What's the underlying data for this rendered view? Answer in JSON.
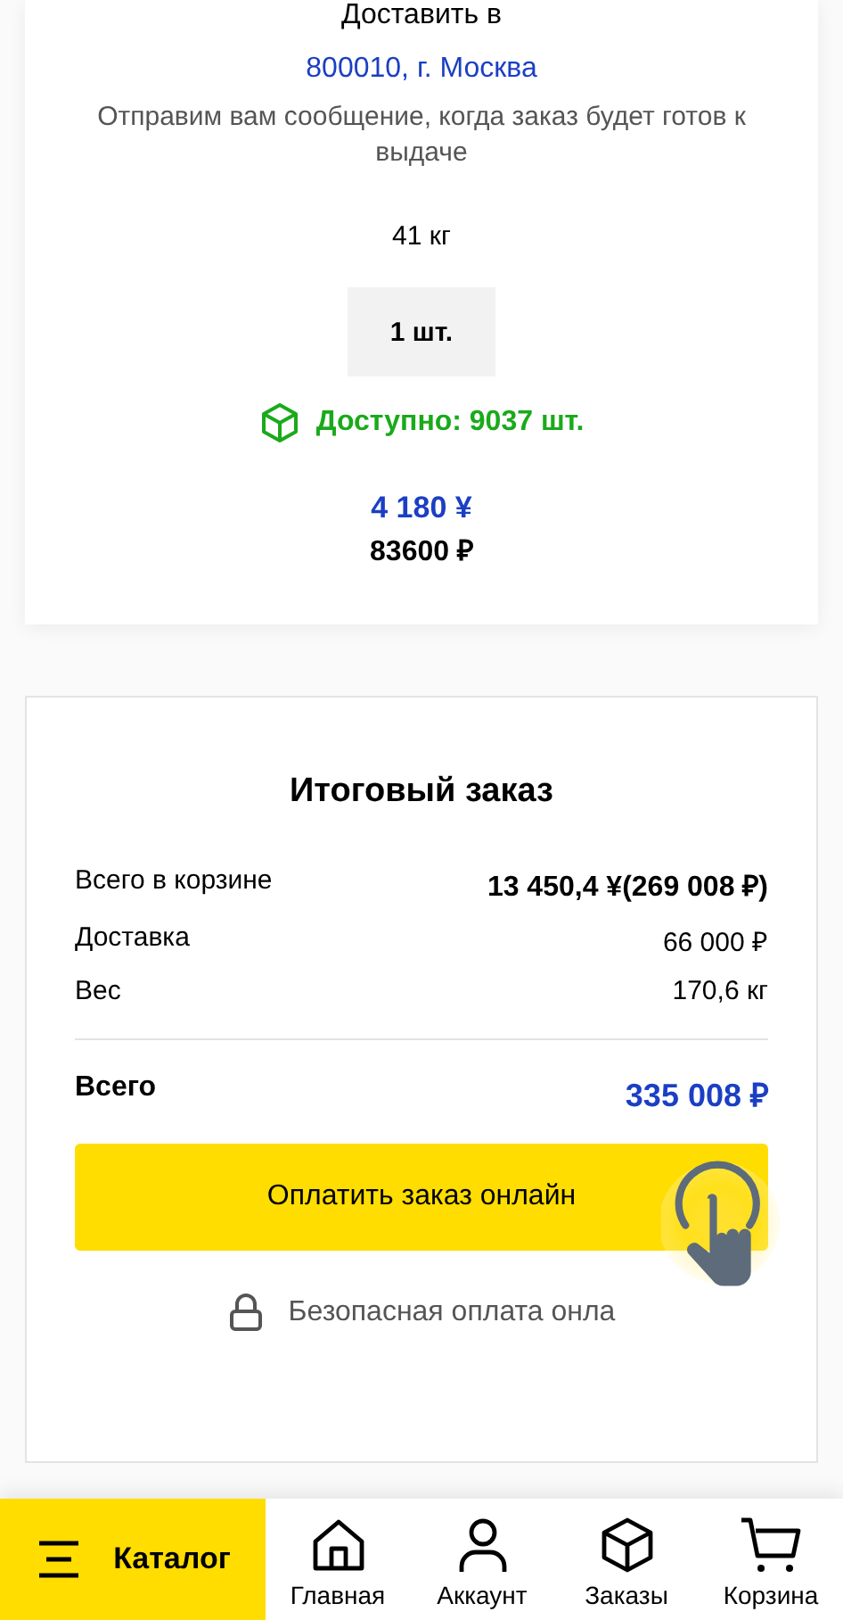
{
  "delivery": {
    "title": "Доставить в",
    "address": "800010, г. Москва",
    "note": "Отправим вам сообщение, когда заказ будет готов к выдаче",
    "weight": "41 кг",
    "quantity": "1 шт.",
    "availability": "Доступно: 9037 шт.",
    "price_cny": "4 180 ¥",
    "price_rub": "83600 ₽"
  },
  "summary": {
    "title": "Итоговый заказ",
    "rows": [
      {
        "label": "Всего в корзине",
        "value": "13 450,4 ¥(269 008 ₽)",
        "bold": true
      },
      {
        "label": "Доставка",
        "value": "66 000 ₽",
        "bold": false
      },
      {
        "label": "Вес",
        "value": "170,6 кг",
        "bold": false
      }
    ],
    "total_label": "Всего",
    "total_value": "335 008 ₽",
    "pay_button": "Оплатить заказ онлайн",
    "secure_note": "Безопасная оплата онла"
  },
  "bottom_nav": {
    "catalog": "Каталог",
    "items": [
      {
        "kind": "home",
        "label": "Главная"
      },
      {
        "kind": "account",
        "label": "Аккаунт"
      },
      {
        "kind": "orders",
        "label": "Заказы"
      },
      {
        "kind": "cart",
        "label": "Корзина"
      }
    ]
  }
}
